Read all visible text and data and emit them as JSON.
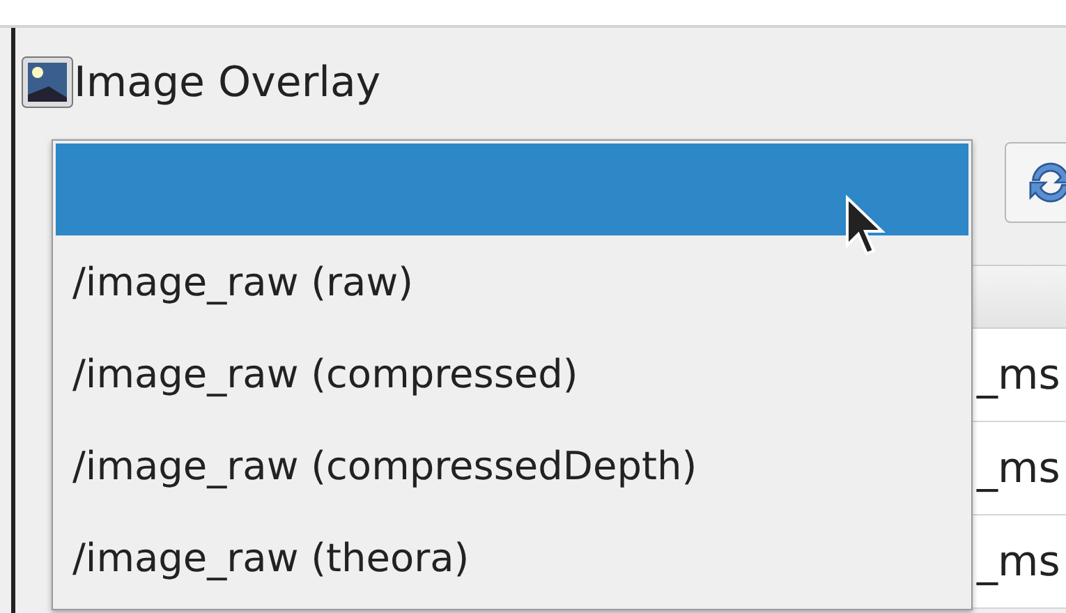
{
  "plugin": {
    "title": "Image Overlay"
  },
  "topic_popup": {
    "blank_row_highlighted": true,
    "options": [
      {
        "label": "/image_raw (raw)",
        "selected": false
      },
      {
        "label": "/image_raw (compressed)",
        "selected": false
      },
      {
        "label": "/image_raw (compressedDepth)",
        "selected": false
      },
      {
        "label": "/image_raw (theora)",
        "selected": false
      }
    ]
  },
  "table": {
    "rows": [
      {
        "column_1": "_ms"
      },
      {
        "column_1": "_ms"
      },
      {
        "column_1": "_ms"
      }
    ]
  }
}
